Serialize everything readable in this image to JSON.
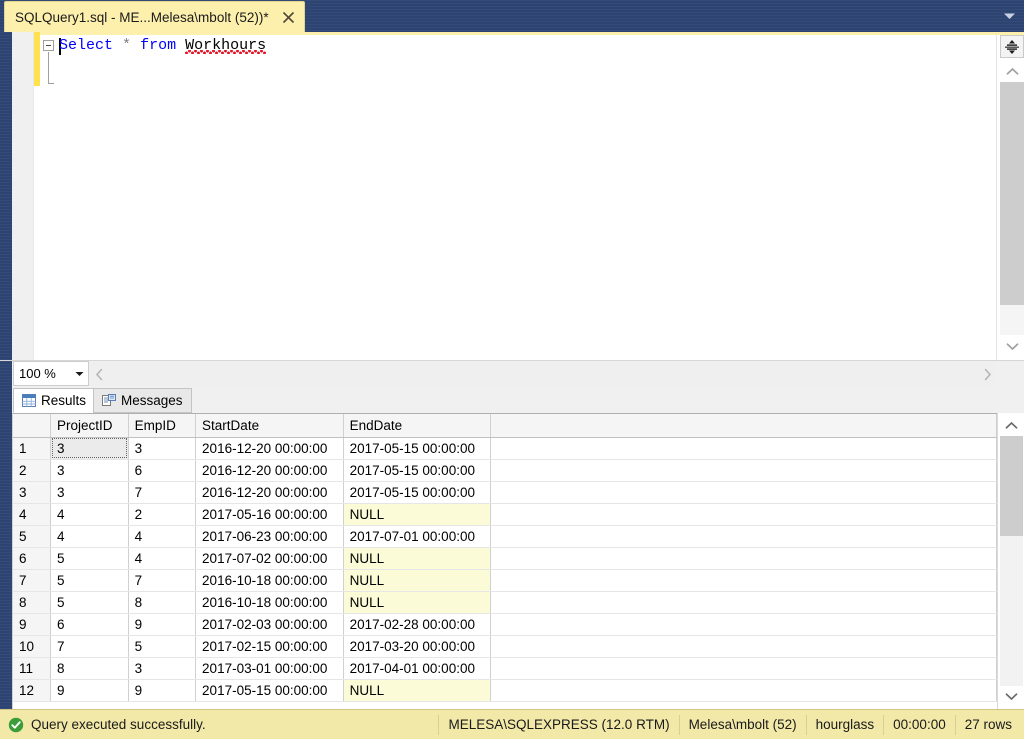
{
  "titlebar": {
    "tab_label": "SQLQuery1.sql - ME...Melesa\\mbolt (52))*",
    "close_icon": "close-icon",
    "dropdown_icon": "chevron-down-icon"
  },
  "editor": {
    "query_tokens": {
      "kw1": "Select",
      "star": "*",
      "kw2": "from",
      "identifier": "Workhours"
    },
    "full_query": "Select * from Workhours",
    "fold_icon": "collapse-minus-icon",
    "splitter_icon": "split-pane-icon",
    "scroll_up_icon": "chevron-up-icon",
    "scroll_down_icon": "chevron-down-icon"
  },
  "zoombar": {
    "zoom_value": "100 %",
    "zoom_caret_icon": "chevron-down-icon",
    "hscroll_left_icon": "chevron-left-icon",
    "hscroll_right_icon": "chevron-right-icon"
  },
  "results_tabs": [
    {
      "label": "Results",
      "icon": "grid-icon",
      "active": true
    },
    {
      "label": "Messages",
      "icon": "message-document-icon",
      "active": false
    }
  ],
  "grid": {
    "columns": [
      "ProjectID",
      "EmpID",
      "StartDate",
      "EndDate"
    ],
    "rows": [
      {
        "n": "1",
        "ProjectID": "3",
        "EmpID": "3",
        "StartDate": "2016-12-20 00:00:00",
        "EndDate": "2017-05-15 00:00:00"
      },
      {
        "n": "2",
        "ProjectID": "3",
        "EmpID": "6",
        "StartDate": "2016-12-20 00:00:00",
        "EndDate": "2017-05-15 00:00:00"
      },
      {
        "n": "3",
        "ProjectID": "3",
        "EmpID": "7",
        "StartDate": "2016-12-20 00:00:00",
        "EndDate": "2017-05-15 00:00:00"
      },
      {
        "n": "4",
        "ProjectID": "4",
        "EmpID": "2",
        "StartDate": "2017-05-16 00:00:00",
        "EndDate": "NULL"
      },
      {
        "n": "5",
        "ProjectID": "4",
        "EmpID": "4",
        "StartDate": "2017-06-23 00:00:00",
        "EndDate": "2017-07-01 00:00:00"
      },
      {
        "n": "6",
        "ProjectID": "5",
        "EmpID": "4",
        "StartDate": "2017-07-02 00:00:00",
        "EndDate": "NULL"
      },
      {
        "n": "7",
        "ProjectID": "5",
        "EmpID": "7",
        "StartDate": "2016-10-18 00:00:00",
        "EndDate": "NULL"
      },
      {
        "n": "8",
        "ProjectID": "5",
        "EmpID": "8",
        "StartDate": "2016-10-18 00:00:00",
        "EndDate": "NULL"
      },
      {
        "n": "9",
        "ProjectID": "6",
        "EmpID": "9",
        "StartDate": "2017-02-03 00:00:00",
        "EndDate": "2017-02-28 00:00:00"
      },
      {
        "n": "10",
        "ProjectID": "7",
        "EmpID": "5",
        "StartDate": "2017-02-15 00:00:00",
        "EndDate": "2017-03-20 00:00:00"
      },
      {
        "n": "11",
        "ProjectID": "8",
        "EmpID": "3",
        "StartDate": "2017-03-01 00:00:00",
        "EndDate": "2017-04-01 00:00:00"
      },
      {
        "n": "12",
        "ProjectID": "9",
        "EmpID": "9",
        "StartDate": "2017-05-15 00:00:00",
        "EndDate": "NULL"
      }
    ],
    "null_text": "NULL",
    "scroll_up_icon": "chevron-up-icon",
    "scroll_down_icon": "chevron-down-icon"
  },
  "statusbar": {
    "status_icon": "success-check-icon",
    "status_text": "Query executed successfully.",
    "server": "MELESA\\SQLEXPRESS (12.0 RTM)",
    "user": "Melesa\\mbolt (52)",
    "database": "hourglass",
    "elapsed": "00:00:00",
    "rows": "27 rows"
  },
  "colors": {
    "titlebar_bg": "#2d4472",
    "tab_bg": "#fdf0ad",
    "keyword": "#0000ff",
    "squiggle": "#e81123",
    "null_cell_bg": "#fbfbd8",
    "statusbar_bg": "#f2e9a8",
    "success_green": "#3a9c3a",
    "change_marker": "#ffe24d"
  }
}
